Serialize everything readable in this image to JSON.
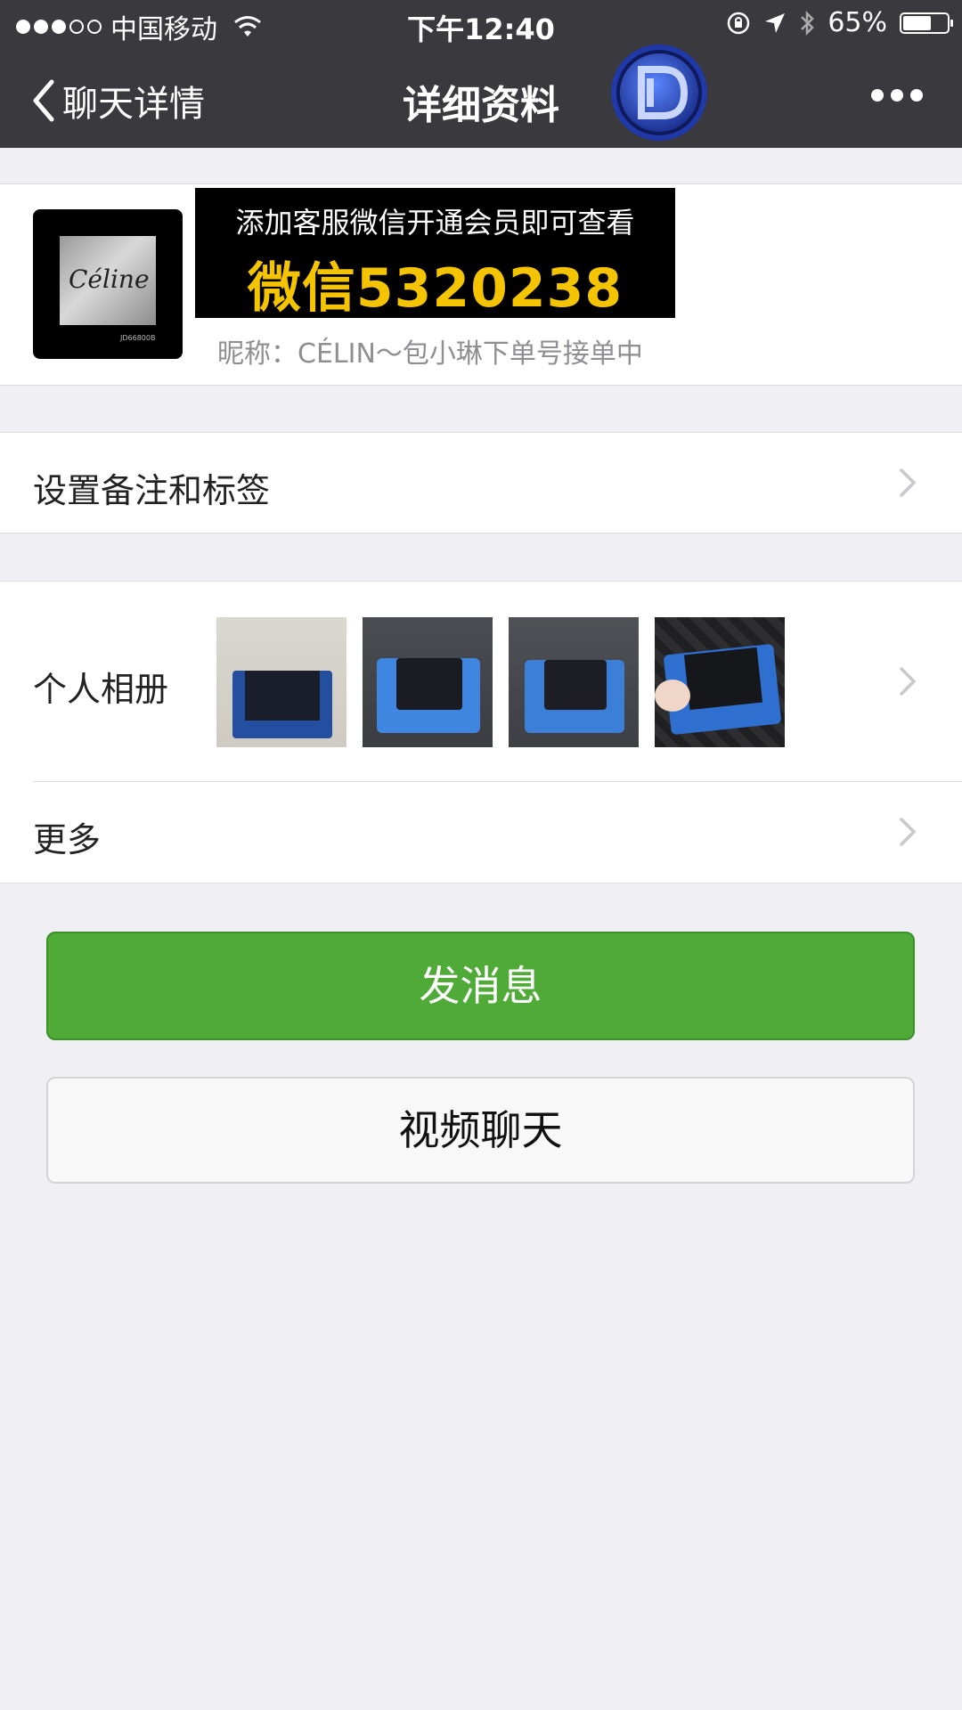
{
  "status_bar": {
    "carrier": "中国移动",
    "time": "下午12:40",
    "battery": "65%",
    "battery_level": 0.65
  },
  "nav": {
    "back_label": "聊天详情",
    "title": "详细资料"
  },
  "profile": {
    "banner_line1": "添加客服微信开通会员即可查看",
    "banner_line2": "微信5320238",
    "nickname": "昵称：CÉLIN～包小琳下单号接单中",
    "avatar_text": "Céline",
    "avatar_small_text": "JD66800B"
  },
  "rows": {
    "remark_label": "设置备注和标签",
    "album_label": "个人相册",
    "more_label": "更多"
  },
  "buttons": {
    "send_label": "发消息",
    "video_label": "视频聊天"
  },
  "colors": {
    "nav_bg": "#39393e",
    "send_green": "#4faa38",
    "banner_yellow": "#f5c400"
  }
}
